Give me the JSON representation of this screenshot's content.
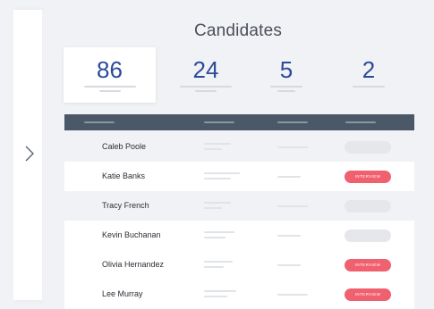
{
  "sidebar": {
    "toggle_icon": "chevron-right-icon"
  },
  "title": "Candidates",
  "stats": [
    {
      "value": "86",
      "active": true
    },
    {
      "value": "24",
      "active": false
    },
    {
      "value": "5",
      "active": false
    },
    {
      "value": "2",
      "active": false
    }
  ],
  "rows": [
    {
      "name": "Caleb Poole",
      "status": ""
    },
    {
      "name": "Katie Banks",
      "status": "INTERVIEW"
    },
    {
      "name": "Tracy French",
      "status": ""
    },
    {
      "name": "Kevin Buchanan",
      "status": ""
    },
    {
      "name": "Olivia Hernandez",
      "status": "INTERVIEW"
    },
    {
      "name": "Lee Murray",
      "status": "INTERVIEW"
    }
  ],
  "colors": {
    "accent": "#2b4a99",
    "header": "#4a5867",
    "interview": "#f0606f"
  }
}
